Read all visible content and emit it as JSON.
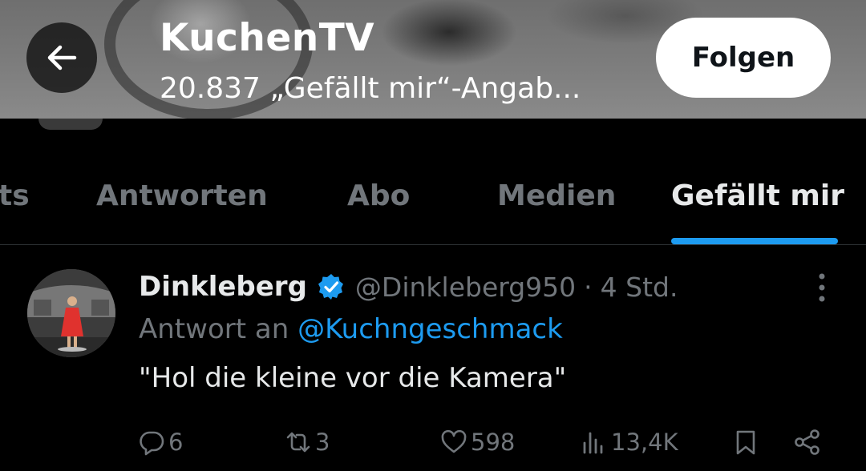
{
  "header": {
    "title": "KuchenTV",
    "subtitle": "20.837 „Gefällt mir“-Angab...",
    "back_icon": "arrow-left-icon",
    "follow_label": "Folgen"
  },
  "tabs": [
    {
      "label": "ts",
      "active": false
    },
    {
      "label": "Antworten",
      "active": false
    },
    {
      "label": "Abo",
      "active": false
    },
    {
      "label": "Medien",
      "active": false
    },
    {
      "label": "Gefällt mir",
      "active": true
    }
  ],
  "post": {
    "author": "Dinkleberg",
    "verified": true,
    "handle": "@Dinkleberg950",
    "separator": "·",
    "time": "4 Std.",
    "reply_prefix": "Antwort an",
    "reply_to": "@Kuchngeschmack",
    "text": "\"Hol die kleine vor die Kamera\"",
    "actions": {
      "replies": "6",
      "reposts": "3",
      "likes": "598",
      "views": "13,4K"
    }
  },
  "colors": {
    "background": "#000000",
    "accent": "#1d9bf0",
    "muted": "#71767b",
    "text": "#e7e9ea"
  }
}
